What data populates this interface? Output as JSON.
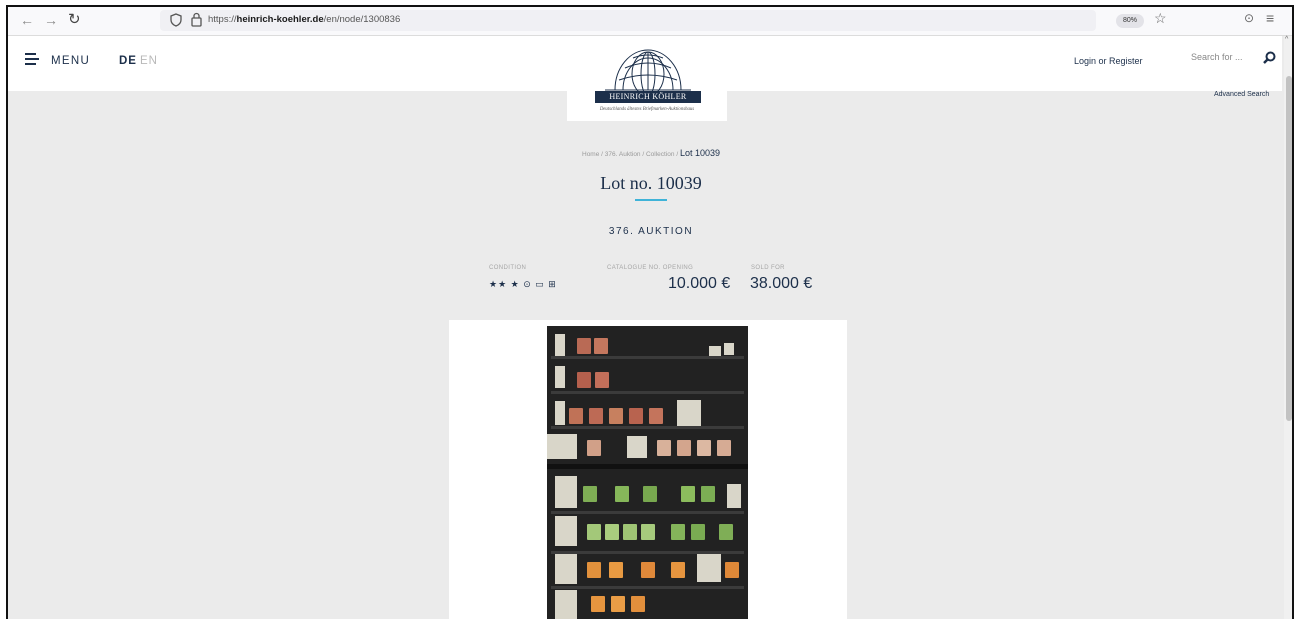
{
  "browser": {
    "url_prefix": "https://",
    "url_domain": "heinrich-koehler.de",
    "url_path": "/en/node/1300836",
    "zoom": "80%",
    "back_icon": "back-arrow-icon",
    "forward_icon": "forward-arrow-icon",
    "reload_icon": "reload-icon"
  },
  "header": {
    "menu_label": "MENU",
    "lang_de": "DE",
    "lang_en": "EN",
    "login_register": "Login or Register",
    "search_placeholder": "Search for ...",
    "advanced_search": "Advanced Search"
  },
  "logo": {
    "name": "HEINRICH KÖHLER",
    "tagline": "Deutschlands ältestes Briefmarken-Auktionshaus"
  },
  "breadcrumb": {
    "items": [
      "Home",
      "376. Auktion",
      "Collection"
    ],
    "current": "Lot 10039"
  },
  "lot": {
    "title": "Lot no. 10039",
    "auction": "376. AUKTION",
    "condition_label": "CONDITION",
    "condition_symbols": "★★ ★ ⊙ ▭ ⊞",
    "catalogue_label": "CATALOGUE NO. OPENING",
    "opening_price": "10.000 €",
    "sold_label": "SOLD FOR",
    "sold_price": "38.000 €"
  },
  "colors": {
    "brand_navy": "#1c2f4a",
    "accent": "#3fb3d8",
    "page_bg": "#ebebeb"
  }
}
